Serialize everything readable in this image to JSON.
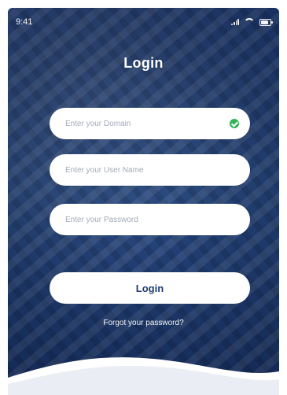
{
  "status_bar": {
    "time": "9:41"
  },
  "screen": {
    "title": "Login"
  },
  "form": {
    "domain_placeholder": "Enter your Domain",
    "username_placeholder": "Enter your User Name",
    "password_placeholder": "Enter your Password",
    "login_label": "Login",
    "forgot_label": "Forgot your password?"
  },
  "colors": {
    "brand_blue": "#1f3d78",
    "success_green": "#33b35a",
    "white": "#ffffff"
  },
  "icons": {
    "domain_valid": "check-circle-icon"
  }
}
